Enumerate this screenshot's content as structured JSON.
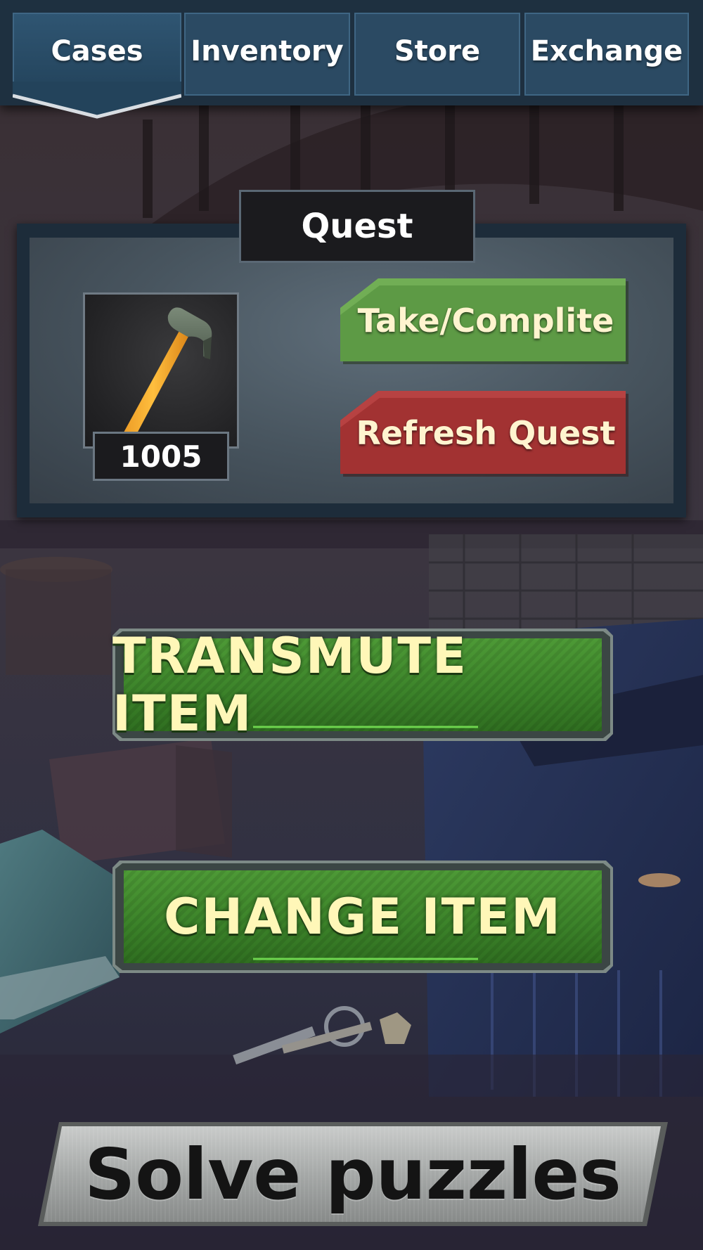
{
  "tabs": [
    {
      "label": "Cases",
      "active": true
    },
    {
      "label": "Inventory",
      "active": false
    },
    {
      "label": "Store",
      "active": false
    },
    {
      "label": "Exchange",
      "active": false
    }
  ],
  "quest": {
    "title": "Quest",
    "item_icon": "hammer-icon",
    "item_count": "1005",
    "take_label": "Take/Complite",
    "refresh_label": "Refresh Quest"
  },
  "actions": {
    "transmute_label": "TRANSMUTE ITEM",
    "change_label": "CHANGE ITEM",
    "solve_label": "Solve puzzles"
  },
  "colors": {
    "tab_bg": "#2b4a63",
    "take_green": "#5d9a45",
    "refresh_red": "#a23232",
    "action_green": "#3e8a2c",
    "action_text": "#fff7b8"
  }
}
